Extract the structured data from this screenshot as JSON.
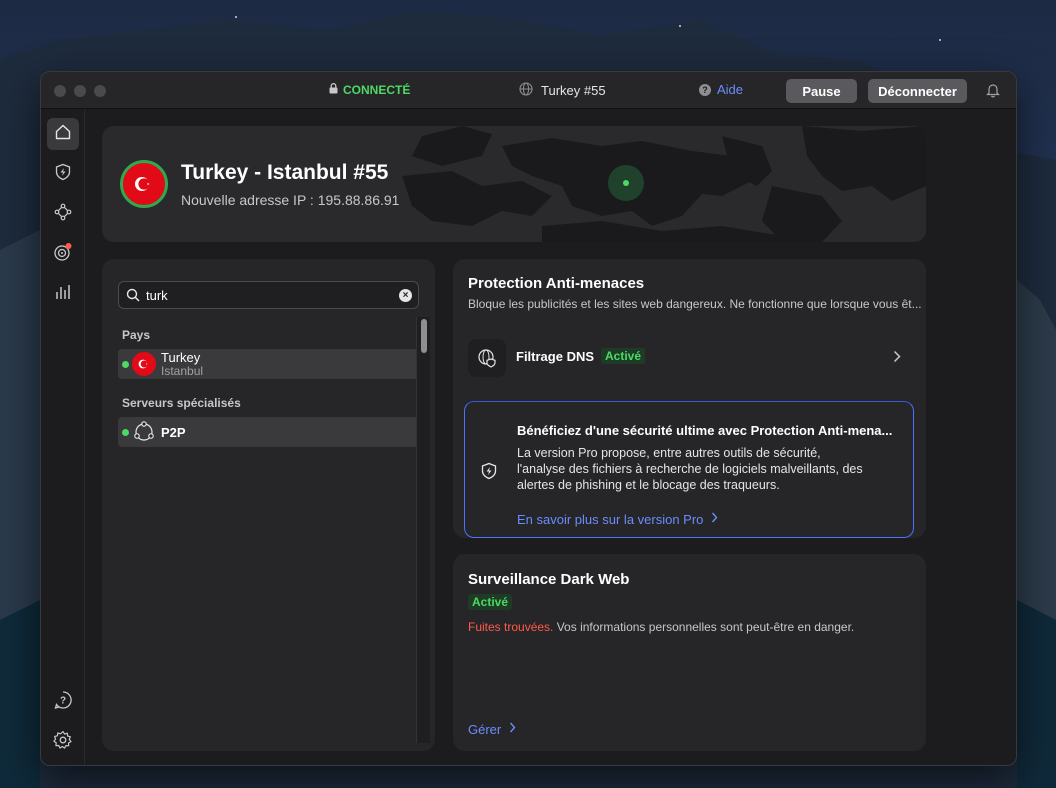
{
  "window": {
    "status": "CONNECTÉ",
    "server": "Turkey #55",
    "help_label": "Aide",
    "pause_label": "Pause",
    "disconnect_label": "Déconnecter"
  },
  "colors": {
    "connected": "#4cd964",
    "link": "#6a8cff",
    "warning": "#ff5a4a",
    "panel": "#262628",
    "window": "#1c1c1e"
  },
  "sidebar": {
    "items": [
      {
        "icon": "home-icon"
      },
      {
        "icon": "shield-bolt-icon"
      },
      {
        "icon": "network-nodes-icon"
      },
      {
        "icon": "radar-target-icon"
      },
      {
        "icon": "stats-bars-icon"
      }
    ],
    "bottom": [
      {
        "icon": "help-icon"
      },
      {
        "icon": "settings-gear-icon"
      }
    ]
  },
  "hero": {
    "title": "Turkey - Istanbul #55",
    "ip_line": "Nouvelle adresse IP : 195.88.86.91"
  },
  "servers": {
    "search_value": "turk",
    "section_countries": "Pays",
    "country": {
      "name": "Turkey",
      "city": "Istanbul"
    },
    "section_special": "Serveurs spécialisés",
    "special": {
      "name": "P2P"
    }
  },
  "threat": {
    "title": "Protection Anti-menaces",
    "desc": "Bloque les publicités et les sites web dangereux. Ne fonctionne que lorsque vous êt...",
    "dns_label": "Filtrage DNS",
    "dns_status": "Activé",
    "pro_title": "Bénéficiez d'une sécurité ultime avec Protection Anti-mena...",
    "pro_line1": "La version Pro propose, entre autres outils de sécurité,",
    "pro_line2": "l'analyse des fichiers à recherche de logiciels malveillants, des",
    "pro_line3": "alertes de phishing et le blocage des traqueurs.",
    "pro_link": "En savoir plus sur la version Pro"
  },
  "darkweb": {
    "title": "Surveillance Dark Web",
    "status": "Activé",
    "warning": "Fuites trouvées.",
    "message": "Vos informations personnelles sont peut-être en danger.",
    "manage_link": "Gérer"
  }
}
